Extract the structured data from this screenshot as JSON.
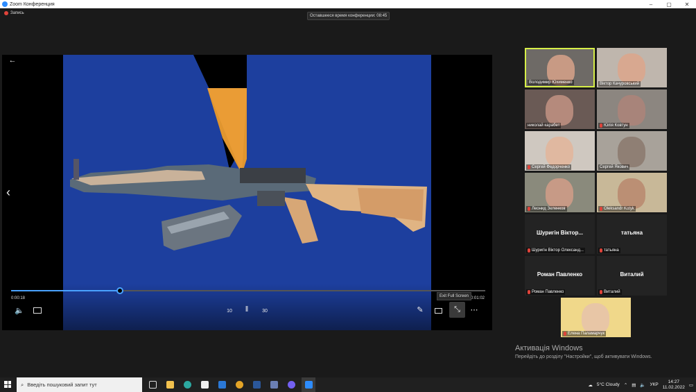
{
  "window": {
    "title": "Zoom Конференция",
    "minimize": "–",
    "maximize": "▢",
    "close": "✕"
  },
  "recording": {
    "label": "Запись"
  },
  "meeting": {
    "time_left": "Оставшееся время конференции: 08:45"
  },
  "player": {
    "current_time": "0:00:18",
    "end_time": "0:01:02",
    "progress": 0.229,
    "tooltip": "Exit Full Screen",
    "icons": {
      "back": "arrow-left-icon",
      "prev": "chevron-left-icon",
      "volume": "volume-icon",
      "subtitles": "subtitles-icon",
      "rewind": "rewind-10-icon",
      "pause": "pause-icon",
      "forward": "forward-30-icon",
      "pen": "pen-icon",
      "miniplayer": "miniplayer-icon",
      "exit_fullscreen": "exit-fullscreen-icon",
      "more": "more-icon"
    },
    "rewind_label": "10",
    "forward_label": "30"
  },
  "participants": [
    {
      "name": "Володимир Юхименко",
      "muted": false,
      "video": true,
      "active": true
    },
    {
      "name": "Віктор Качуровський",
      "muted": false,
      "video": true
    },
    {
      "name": "николай карабет",
      "muted": false,
      "video": true
    },
    {
      "name": "Юлія Ковтун",
      "muted": true,
      "video": true
    },
    {
      "name": "Сергей Федорченко",
      "muted": true,
      "video": true
    },
    {
      "name": "Сергей Якович",
      "muted": false,
      "video": true
    },
    {
      "name": "Леонид Зеленков",
      "muted": true,
      "video": true
    },
    {
      "name": "Oleksandr Kotyk",
      "muted": true,
      "video": true
    },
    {
      "name": "Шуригін Віктор Олександ...",
      "display": "Шуригін Віктор...",
      "muted": true,
      "video": false
    },
    {
      "name": "татьяна",
      "display": "татьяна",
      "muted": true,
      "video": false
    },
    {
      "name": "Роман Павленко",
      "display": "Роман Павленко",
      "muted": true,
      "video": false
    },
    {
      "name": "Виталий",
      "display": "Виталий",
      "muted": true,
      "video": false
    },
    {
      "name": "Елена Паламарчук",
      "muted": true,
      "video": true
    }
  ],
  "activation": {
    "title": "Активація Windows",
    "subtitle": "Перейдіть до розділу \"Настройки\", щоб активувати Windows."
  },
  "taskbar": {
    "search_placeholder": "Введіть пошуковий запит тут",
    "weather": "5°C  Cloudy",
    "language": "УКР",
    "time": "14:27",
    "date": "11.02.2022"
  },
  "colors": {
    "accent": "#4aa3ff",
    "active_speaker": "#d7ef48",
    "video_bg": "#1d3f9e",
    "muted": "#e0433a"
  }
}
